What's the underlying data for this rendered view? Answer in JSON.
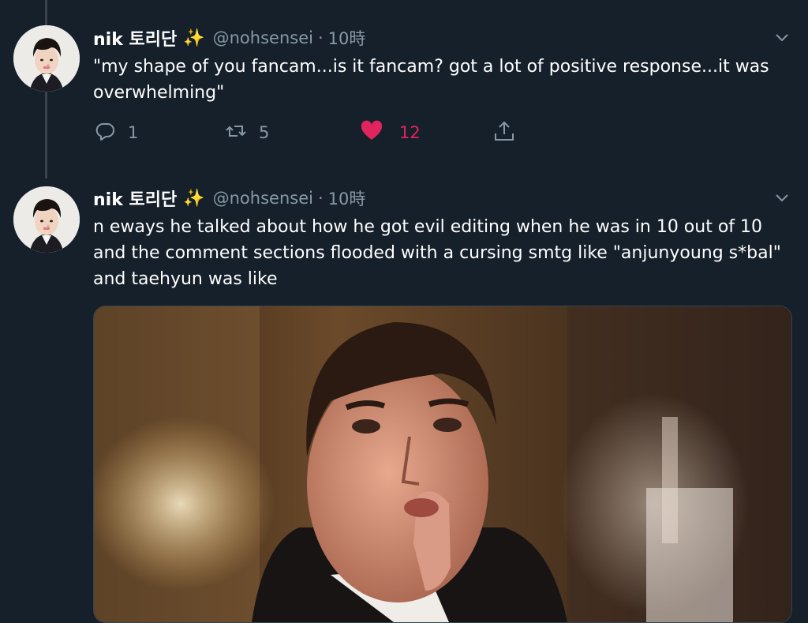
{
  "tweets": [
    {
      "name": "nik 토리단",
      "emoji": "✨",
      "handle": "@nohsensei",
      "separator": "·",
      "time": "10時",
      "text": "\"my shape of you fancam...is it fancam? got a lot of positive response...it was overwhelming\"",
      "actions": {
        "reply_count": "1",
        "retweet_count": "5",
        "like_count": "12"
      }
    },
    {
      "name": "nik 토리단",
      "emoji": "✨",
      "handle": "@nohsensei",
      "separator": "·",
      "time": "10時",
      "text": "n eways he talked about how he got evil editing when he was in 10 out of 10 and the comment sections flooded with a cursing smtg like \"anjunyoung s*bal\" and taehyun was like"
    }
  ],
  "icons": {
    "reply": "reply-icon",
    "retweet": "retweet-icon",
    "like": "heart-icon",
    "share": "share-icon",
    "more": "chevron-down-icon"
  },
  "colors": {
    "background": "#15202b",
    "secondary_text": "#8899a6",
    "like_active": "#e0245e"
  }
}
